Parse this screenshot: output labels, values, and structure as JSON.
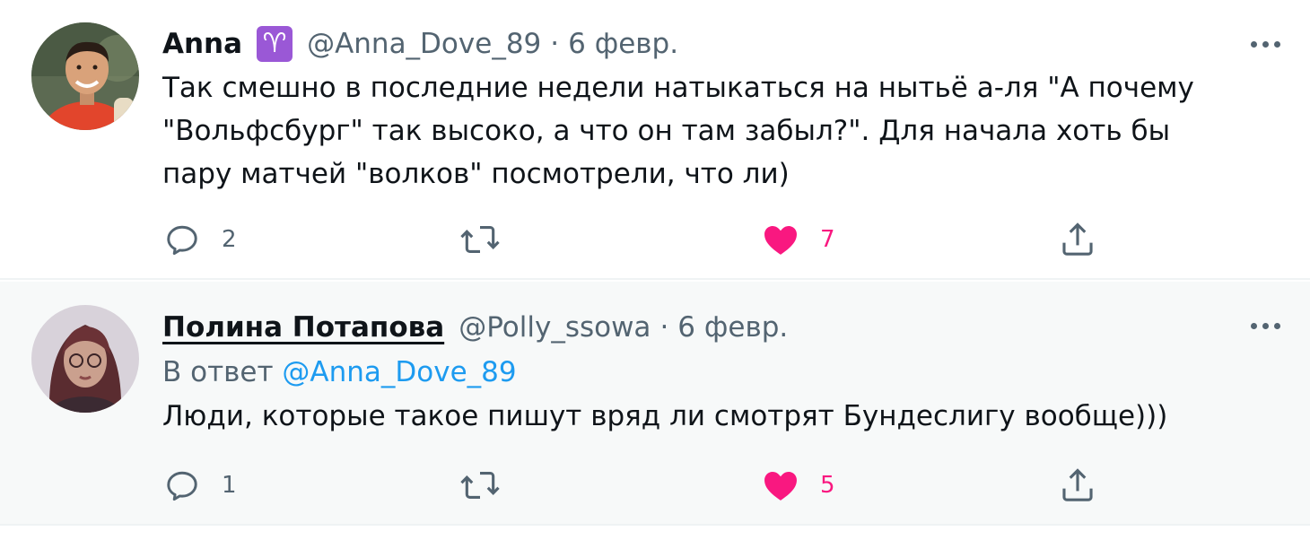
{
  "tweets": [
    {
      "author": {
        "name": "Anna",
        "badge": "♈",
        "handle": "@Anna_Dove_89"
      },
      "separator": "·",
      "date": "6 февр.",
      "text": "Так смешно в последние недели натыкаться на нытьё а-ля \"А почему \"Вольфсбург\" так высоко, а что он там забыл?\". Для начала хоть бы пару матчей \"волков\" посмотрели, что ли)",
      "stats": {
        "replies": "2",
        "retweets": "",
        "likes": "7"
      },
      "liked": true
    },
    {
      "author": {
        "name": "Полина Потапова",
        "handle": "@Polly_ssowa"
      },
      "separator": "·",
      "date": "6 февр.",
      "reply_to": {
        "prefix": "В ответ",
        "mention": "@Anna_Dove_89"
      },
      "text": "Люди, которые такое пишут вряд ли смотрят Бундеслигу вообще)))",
      "stats": {
        "replies": "1",
        "retweets": "",
        "likes": "5"
      },
      "liked": true
    }
  ],
  "icons": {
    "reply": "reply-icon",
    "retweet": "retweet-icon",
    "like": "heart-icon",
    "share": "share-icon",
    "more": "more-icon"
  },
  "colors": {
    "text": "#0f1419",
    "secondary": "#536471",
    "link": "#1d9bf0",
    "like": "#f91880",
    "aries_badge": "#9a58d6",
    "highlight_bg": "#f7f9f9"
  }
}
